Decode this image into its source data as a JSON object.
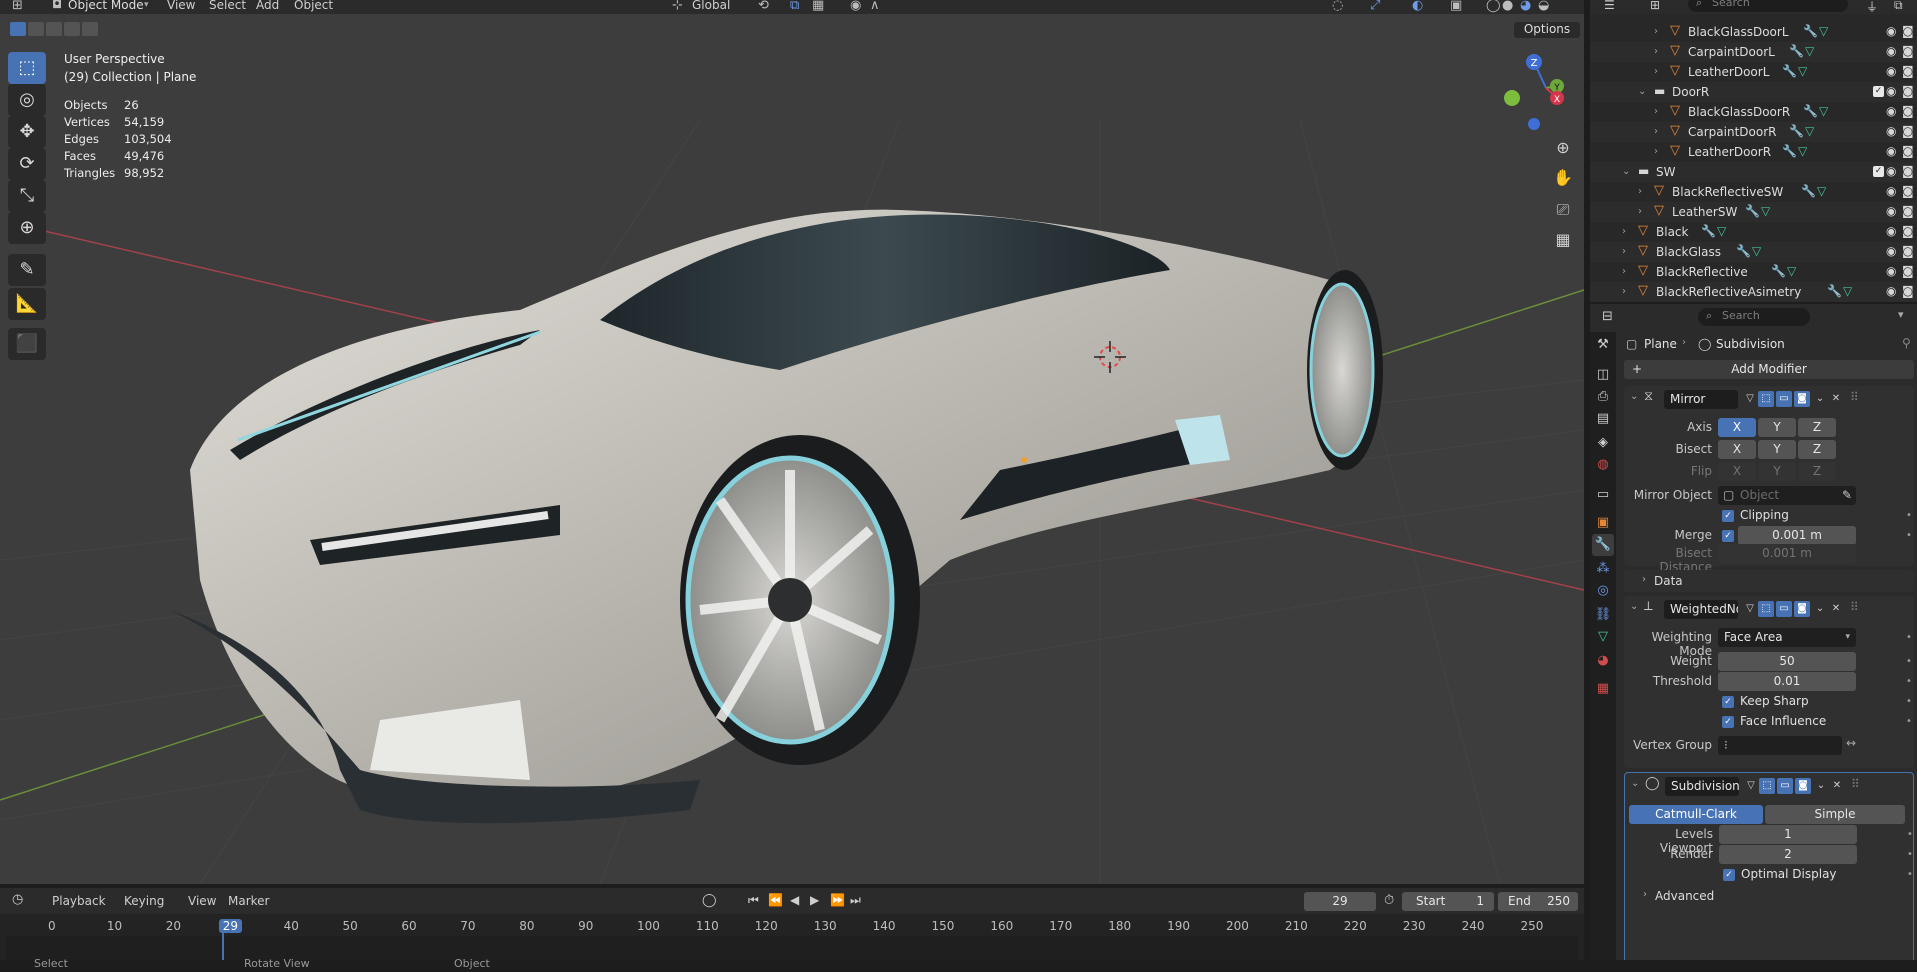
{
  "header": {
    "mode": "Object Mode",
    "menus": [
      "View",
      "Select",
      "Add",
      "Object"
    ],
    "orientation": "Global",
    "options_label": "Options"
  },
  "viewport": {
    "view_name": "User Perspective",
    "collection_line": "(29) Collection | Plane",
    "stats": [
      {
        "label": "Objects",
        "value": "26"
      },
      {
        "label": "Vertices",
        "value": "54,159"
      },
      {
        "label": "Edges",
        "value": "103,504"
      },
      {
        "label": "Faces",
        "value": "49,476"
      },
      {
        "label": "Triangles",
        "value": "98,952"
      }
    ],
    "gizmo": {
      "x": "X",
      "y": "Y",
      "z": "Z"
    }
  },
  "toolbar": {
    "tools": [
      {
        "name": "select-box-tool",
        "glyph": "⬚"
      },
      {
        "name": "cursor-tool",
        "glyph": "◎"
      },
      {
        "name": "move-tool",
        "glyph": "✥"
      },
      {
        "name": "rotate-tool",
        "glyph": "⟳"
      },
      {
        "name": "scale-tool",
        "glyph": "⤡"
      },
      {
        "name": "transform-tool",
        "glyph": "⊕"
      },
      {
        "name": "annotate-tool",
        "glyph": "✎"
      },
      {
        "name": "measure-tool",
        "glyph": "📐"
      },
      {
        "name": "add-cube-tool",
        "glyph": "⬛"
      }
    ]
  },
  "outliner": {
    "search_placeholder": "Search",
    "rows": [
      {
        "name": "BlackGlassDoorL",
        "type": "mesh"
      },
      {
        "name": "CarpaintDoorL",
        "type": "mesh"
      },
      {
        "name": "LeatherDoorL",
        "type": "mesh"
      },
      {
        "name": "DoorR",
        "type": "collection"
      },
      {
        "name": "BlackGlassDoorR",
        "type": "mesh"
      },
      {
        "name": "CarpaintDoorR",
        "type": "mesh"
      },
      {
        "name": "LeatherDoorR",
        "type": "mesh"
      },
      {
        "name": "SW",
        "type": "collection"
      },
      {
        "name": "BlackReflectiveSW",
        "type": "mesh"
      },
      {
        "name": "LeatherSW",
        "type": "mesh"
      },
      {
        "name": "Black",
        "type": "mesh"
      },
      {
        "name": "BlackGlass",
        "type": "mesh"
      },
      {
        "name": "BlackReflective",
        "type": "mesh"
      },
      {
        "name": "BlackReflectiveAsimetry",
        "type": "mesh"
      }
    ]
  },
  "properties": {
    "search_placeholder": "Search",
    "breadcrumb_object": "Plane",
    "breadcrumb_modifier": "Subdivision",
    "add_modifier": "Add Modifier",
    "mirror": {
      "name": "Mirror",
      "axis_label": "Axis",
      "bisect_label": "Bisect",
      "flip_label": "Flip",
      "axes": [
        "X",
        "Y",
        "Z"
      ],
      "mirror_object_label": "Mirror Object",
      "mirror_object_placeholder": "Object",
      "clipping_label": "Clipping",
      "merge_label": "Merge",
      "merge_value": "0.001 m",
      "bisect_distance_label": "Bisect Distance",
      "bisect_distance_value": "0.001 m",
      "data_label": "Data"
    },
    "weighted": {
      "name": "WeightedNo...",
      "mode_label": "Weighting Mode",
      "mode_value": "Face Area",
      "weight_label": "Weight",
      "weight_value": "50",
      "threshold_label": "Threshold",
      "threshold_value": "0.01",
      "keep_sharp_label": "Keep Sharp",
      "face_influence_label": "Face Influence",
      "vertex_group_label": "Vertex Group"
    },
    "subdivision": {
      "name": "Subdivision",
      "catmull": "Catmull-Clark",
      "simple": "Simple",
      "levels_viewport_label": "Levels Viewport",
      "levels_viewport_value": "1",
      "render_label": "Render",
      "render_value": "2",
      "optimal_display_label": "Optimal Display",
      "advanced_label": "Advanced"
    }
  },
  "timeline": {
    "menus": [
      "Playback",
      "Keying",
      "View",
      "Marker"
    ],
    "current_frame": "29",
    "start_label": "Start",
    "start_value": "1",
    "end_label": "End",
    "end_value": "250",
    "ticks": [
      "0",
      "10",
      "20",
      "29",
      "40",
      "50",
      "60",
      "70",
      "80",
      "90",
      "100",
      "110",
      "120",
      "130",
      "140",
      "150",
      "160",
      "170",
      "180",
      "190",
      "200",
      "210",
      "220",
      "230",
      "240",
      "250"
    ]
  },
  "statusbar": {
    "items": [
      "Select",
      "Rotate View",
      "Object"
    ]
  },
  "colors": {
    "accent": "#4772b3",
    "mesh_icon": "#e38638",
    "modifier_icon": "#7ea3e8",
    "data_icon": "#43c49a"
  }
}
